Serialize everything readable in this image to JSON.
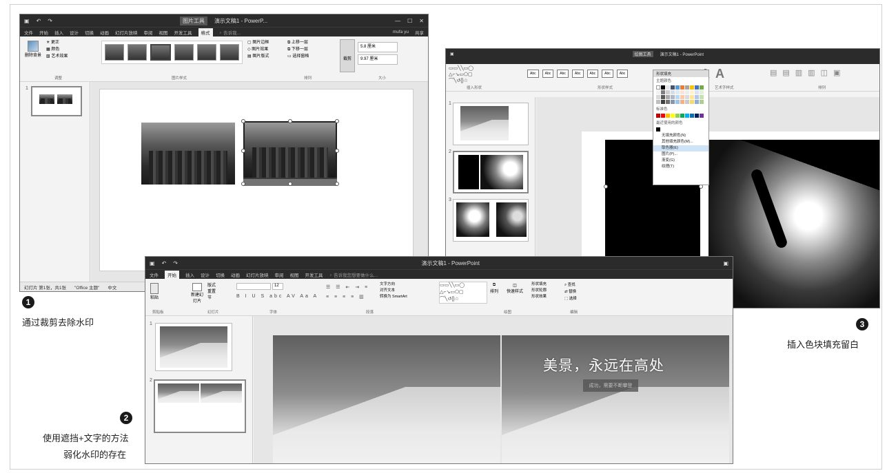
{
  "win1": {
    "title": "演示文稿1 - PowerP...",
    "context_tab": "图片工具",
    "tabs": [
      "文件",
      "开始",
      "插入",
      "设计",
      "切换",
      "动画",
      "幻灯片放映",
      "审阅",
      "视图",
      "开发工具",
      "格式"
    ],
    "active_tab": "格式",
    "search": "♀ 告诉我...",
    "user": "mufa yu",
    "share": "共享",
    "group_adjust": "调整",
    "group_styles": "图片样式",
    "group_arrange": "排列",
    "group_size": "大小",
    "remove_bg": "删除背景",
    "correct": "更正",
    "color": "颜色",
    "art_effect": "艺术效果",
    "border": "图片边框",
    "effects": "图片效果",
    "layout": "图片版式",
    "up_layer": "上移一层",
    "down_layer": "下移一层",
    "select_pane": "选择窗格",
    "crop": "裁剪",
    "height": "5.8 厘米",
    "width": "9.97 厘米",
    "status": "幻灯片 第1张，共1张",
    "theme": "\"Office 主题\"",
    "lang": "中文"
  },
  "win2": {
    "title": "演示文稿1 - PowerPoint",
    "context_tab": "绘图工具",
    "menu_title": "形状填充",
    "theme_colors": "主题颜色",
    "standard_colors": "标准色",
    "recent_colors": "最近使用的颜色",
    "menu_items": [
      "无填充颜色(N)",
      "其他填充颜色(M)...",
      "取色器(E)",
      "图片(P)...",
      "渐变(G)",
      "纹理(T)"
    ],
    "group_insert_shape": "插入形状",
    "group_shape_styles": "形状样式",
    "group_art": "艺术字样式",
    "group_arrange": "排列",
    "shape_samples": [
      "Abc",
      "Abc",
      "Abc",
      "Abc",
      "Abc",
      "Abc",
      "Abc"
    ]
  },
  "win3": {
    "title": "演示文稿1 - PowerPoint",
    "tabs": [
      "文件",
      "开始",
      "插入",
      "设计",
      "切换",
      "动画",
      "幻灯片放映",
      "审阅",
      "视图",
      "开发工具"
    ],
    "active_tab": "开始",
    "search": "♀ 告诉我您想要做什么...",
    "groups": [
      "剪贴板",
      "幻灯片",
      "字体",
      "段落",
      "绘图",
      "编辑"
    ],
    "paste": "粘贴",
    "new_slide": "新建幻灯片",
    "layout": "版式",
    "reset": "重置",
    "section": "节",
    "font_size": "12",
    "find": "查找",
    "replace": "替换",
    "select": "选择",
    "arrange": "排列",
    "quick_styles": "快速样式",
    "shape_fill": "形状填充",
    "shape_outline": "形状轮廓",
    "shape_effects": "形状效果",
    "text_dir": "文字方向",
    "align_text": "对齐文本",
    "smartart": "转换为 SmartArt",
    "slide_heading": "美景，永远在高处",
    "slide_sub": "成功，需要不断攀登"
  },
  "captions": {
    "c1": "通过裁剪去除水印",
    "c2_line1": "使用遮挡+文字的方法",
    "c2_line2": "弱化水印的存在",
    "c3": "插入色块填充留白"
  },
  "badges": {
    "b1": "1",
    "b2": "2",
    "b3": "3"
  },
  "thumb_numbers": {
    "w1": "1",
    "w2a": "1",
    "w2b": "2",
    "w2c": "3",
    "w3a": "1",
    "w3b": "2"
  }
}
